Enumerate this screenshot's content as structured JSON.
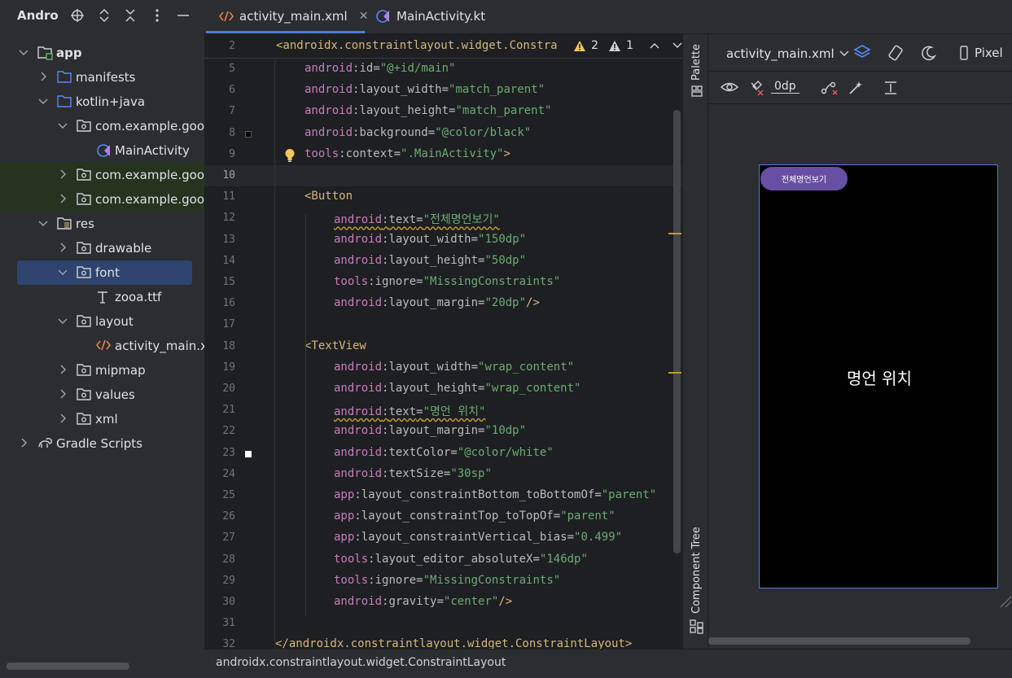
{
  "project_panel": {
    "title": "Andro",
    "tree": [
      {
        "label": "app",
        "depth": 0,
        "expanded": true,
        "icon": "module-folder-icon",
        "bold": true
      },
      {
        "label": "manifests",
        "depth": 1,
        "expanded": false,
        "icon": "folder-icon"
      },
      {
        "label": "kotlin+java",
        "depth": 1,
        "expanded": true,
        "icon": "folder-icon"
      },
      {
        "label": "com.example.goodw",
        "depth": 2,
        "expanded": true,
        "icon": "package-icon"
      },
      {
        "label": "MainActivity",
        "depth": 3,
        "icon": "kotlin-class-icon"
      },
      {
        "label": "com.example.goodw",
        "depth": 2,
        "expanded": false,
        "icon": "package-icon",
        "highlight": "test"
      },
      {
        "label": "com.example.goodw",
        "depth": 2,
        "expanded": false,
        "icon": "package-icon",
        "highlight": "test"
      },
      {
        "label": "res",
        "depth": 1,
        "expanded": true,
        "icon": "res-folder-icon"
      },
      {
        "label": "drawable",
        "depth": 2,
        "expanded": false,
        "icon": "package-icon"
      },
      {
        "label": "font",
        "depth": 2,
        "expanded": true,
        "icon": "package-icon",
        "selected": true
      },
      {
        "label": "zooa.ttf",
        "depth": 3,
        "icon": "font-file-icon"
      },
      {
        "label": "layout",
        "depth": 2,
        "expanded": true,
        "icon": "package-icon"
      },
      {
        "label": "activity_main.xm",
        "depth": 3,
        "icon": "xml-file-icon"
      },
      {
        "label": "mipmap",
        "depth": 2,
        "expanded": false,
        "icon": "package-icon"
      },
      {
        "label": "values",
        "depth": 2,
        "expanded": false,
        "icon": "package-icon"
      },
      {
        "label": "xml",
        "depth": 2,
        "expanded": false,
        "icon": "package-icon"
      },
      {
        "label": "Gradle Scripts",
        "depth": 0,
        "expanded": false,
        "icon": "gradle-icon"
      }
    ]
  },
  "tabs": [
    {
      "label": "activity_main.xml",
      "icon": "xml-file-icon",
      "active": true
    },
    {
      "label": "MainActivity.kt",
      "icon": "kotlin-class-icon",
      "active": false
    }
  ],
  "editor": {
    "sticky_line": {
      "num": "2",
      "text": "<androidx.constraintlayout.widget.Constra"
    },
    "inspections": {
      "warnings": "2",
      "weak_warnings": "1"
    },
    "lines": [
      {
        "num": "5",
        "indent": 1,
        "parts": [
          [
            "ns",
            "android"
          ],
          [
            "eq",
            ":"
          ],
          [
            "attr",
            "id"
          ],
          [
            "eq",
            "="
          ],
          [
            "str",
            "\"@+id/main\""
          ]
        ]
      },
      {
        "num": "6",
        "indent": 1,
        "parts": [
          [
            "ns",
            "android"
          ],
          [
            "eq",
            ":"
          ],
          [
            "attr",
            "layout_width"
          ],
          [
            "eq",
            "="
          ],
          [
            "str",
            "\"match_parent\""
          ]
        ]
      },
      {
        "num": "7",
        "indent": 1,
        "parts": [
          [
            "ns",
            "android"
          ],
          [
            "eq",
            ":"
          ],
          [
            "attr",
            "layout_height"
          ],
          [
            "eq",
            "="
          ],
          [
            "str",
            "\"match_parent\""
          ]
        ]
      },
      {
        "num": "8",
        "indent": 1,
        "gutter": "black",
        "parts": [
          [
            "ns",
            "android"
          ],
          [
            "eq",
            ":"
          ],
          [
            "attr",
            "background"
          ],
          [
            "eq",
            "="
          ],
          [
            "str",
            "\"@color/black\""
          ]
        ]
      },
      {
        "num": "9",
        "indent": 1,
        "bulb": true,
        "parts": [
          [
            "ns",
            "tools"
          ],
          [
            "eq",
            ":"
          ],
          [
            "attr",
            "context"
          ],
          [
            "eq",
            "="
          ],
          [
            "str",
            "\".MainActivity\""
          ],
          [
            "bracket",
            ">"
          ]
        ]
      },
      {
        "num": "10",
        "indent": 0,
        "current": true,
        "parts": []
      },
      {
        "num": "11",
        "indent": 1,
        "parts": [
          [
            "tag",
            "<Button"
          ]
        ]
      },
      {
        "num": "12",
        "indent": 2,
        "squiggle": true,
        "parts": [
          [
            "ns",
            "android"
          ],
          [
            "eq",
            ":"
          ],
          [
            "attr",
            "text"
          ],
          [
            "eq",
            "="
          ],
          [
            "str",
            "\"전체명언보기\""
          ]
        ]
      },
      {
        "num": "13",
        "indent": 2,
        "parts": [
          [
            "ns",
            "android"
          ],
          [
            "eq",
            ":"
          ],
          [
            "attr",
            "layout_width"
          ],
          [
            "eq",
            "="
          ],
          [
            "str",
            "\"150dp\""
          ]
        ]
      },
      {
        "num": "14",
        "indent": 2,
        "parts": [
          [
            "ns",
            "android"
          ],
          [
            "eq",
            ":"
          ],
          [
            "attr",
            "layout_height"
          ],
          [
            "eq",
            "="
          ],
          [
            "str",
            "\"50dp\""
          ]
        ]
      },
      {
        "num": "15",
        "indent": 2,
        "parts": [
          [
            "ns",
            "tools"
          ],
          [
            "eq",
            ":"
          ],
          [
            "attr",
            "ignore"
          ],
          [
            "eq",
            "="
          ],
          [
            "str",
            "\"MissingConstraints\""
          ]
        ]
      },
      {
        "num": "16",
        "indent": 2,
        "parts": [
          [
            "ns",
            "android"
          ],
          [
            "eq",
            ":"
          ],
          [
            "attr",
            "layout_margin"
          ],
          [
            "eq",
            "="
          ],
          [
            "str",
            "\"20dp\""
          ],
          [
            "bracket",
            "/>"
          ]
        ]
      },
      {
        "num": "17",
        "indent": 0,
        "parts": []
      },
      {
        "num": "18",
        "indent": 1,
        "parts": [
          [
            "tag",
            "<TextView"
          ]
        ]
      },
      {
        "num": "19",
        "indent": 2,
        "parts": [
          [
            "ns",
            "android"
          ],
          [
            "eq",
            ":"
          ],
          [
            "attr",
            "layout_width"
          ],
          [
            "eq",
            "="
          ],
          [
            "str",
            "\"wrap_content\""
          ]
        ]
      },
      {
        "num": "20",
        "indent": 2,
        "parts": [
          [
            "ns",
            "android"
          ],
          [
            "eq",
            ":"
          ],
          [
            "attr",
            "layout_height"
          ],
          [
            "eq",
            "="
          ],
          [
            "str",
            "\"wrap_content\""
          ]
        ]
      },
      {
        "num": "21",
        "indent": 2,
        "squiggle": true,
        "parts": [
          [
            "ns",
            "android"
          ],
          [
            "eq",
            ":"
          ],
          [
            "attr",
            "text"
          ],
          [
            "eq",
            "="
          ],
          [
            "str",
            "\"명언 위치\""
          ]
        ]
      },
      {
        "num": "22",
        "indent": 2,
        "parts": [
          [
            "ns",
            "android"
          ],
          [
            "eq",
            ":"
          ],
          [
            "attr",
            "layout_margin"
          ],
          [
            "eq",
            "="
          ],
          [
            "str",
            "\"10dp\""
          ]
        ]
      },
      {
        "num": "23",
        "indent": 2,
        "gutter": "white",
        "parts": [
          [
            "ns",
            "android"
          ],
          [
            "eq",
            ":"
          ],
          [
            "attr",
            "textColor"
          ],
          [
            "eq",
            "="
          ],
          [
            "str",
            "\"@color/white\""
          ]
        ]
      },
      {
        "num": "24",
        "indent": 2,
        "parts": [
          [
            "ns",
            "android"
          ],
          [
            "eq",
            ":"
          ],
          [
            "attr",
            "textSize"
          ],
          [
            "eq",
            "="
          ],
          [
            "str",
            "\"30sp\""
          ]
        ]
      },
      {
        "num": "25",
        "indent": 2,
        "parts": [
          [
            "ns",
            "app"
          ],
          [
            "eq",
            ":"
          ],
          [
            "attr",
            "layout_constraintBottom_toBottomOf"
          ],
          [
            "eq",
            "="
          ],
          [
            "str",
            "\"parent\""
          ]
        ]
      },
      {
        "num": "26",
        "indent": 2,
        "parts": [
          [
            "ns",
            "app"
          ],
          [
            "eq",
            ":"
          ],
          [
            "attr",
            "layout_constraintTop_toTopOf"
          ],
          [
            "eq",
            "="
          ],
          [
            "str",
            "\"parent\""
          ]
        ]
      },
      {
        "num": "27",
        "indent": 2,
        "parts": [
          [
            "ns",
            "app"
          ],
          [
            "eq",
            ":"
          ],
          [
            "attr",
            "layout_constraintVertical_bias"
          ],
          [
            "eq",
            "="
          ],
          [
            "str",
            "\"0.499\""
          ]
        ]
      },
      {
        "num": "28",
        "indent": 2,
        "parts": [
          [
            "ns",
            "tools"
          ],
          [
            "eq",
            ":"
          ],
          [
            "attr",
            "layout_editor_absoluteX"
          ],
          [
            "eq",
            "="
          ],
          [
            "str",
            "\"146dp\""
          ]
        ]
      },
      {
        "num": "29",
        "indent": 2,
        "parts": [
          [
            "ns",
            "tools"
          ],
          [
            "eq",
            ":"
          ],
          [
            "attr",
            "ignore"
          ],
          [
            "eq",
            "="
          ],
          [
            "str",
            "\"MissingConstraints\""
          ]
        ]
      },
      {
        "num": "30",
        "indent": 2,
        "parts": [
          [
            "ns",
            "android"
          ],
          [
            "eq",
            ":"
          ],
          [
            "attr",
            "gravity"
          ],
          [
            "eq",
            "="
          ],
          [
            "str",
            "\"center\""
          ],
          [
            "bracket",
            "/>"
          ]
        ]
      },
      {
        "num": "31",
        "indent": 0,
        "parts": []
      },
      {
        "num": "32",
        "indent": 0,
        "parts": [
          [
            "tag",
            "</androidx.constraintlayout.widget.ConstraintLayout>"
          ]
        ]
      }
    ]
  },
  "side_strip": {
    "palette": "Palette",
    "component_tree": "Component Tree"
  },
  "design": {
    "file_dropdown": "activity_main.xml",
    "device_dropdown": "Pixel",
    "margin_value": "0dp",
    "preview_button": "전체명언보기",
    "preview_text": "명언 위치"
  },
  "status_bar": {
    "breadcrumb": "androidx.constraintlayout.widget.ConstraintLayout"
  }
}
